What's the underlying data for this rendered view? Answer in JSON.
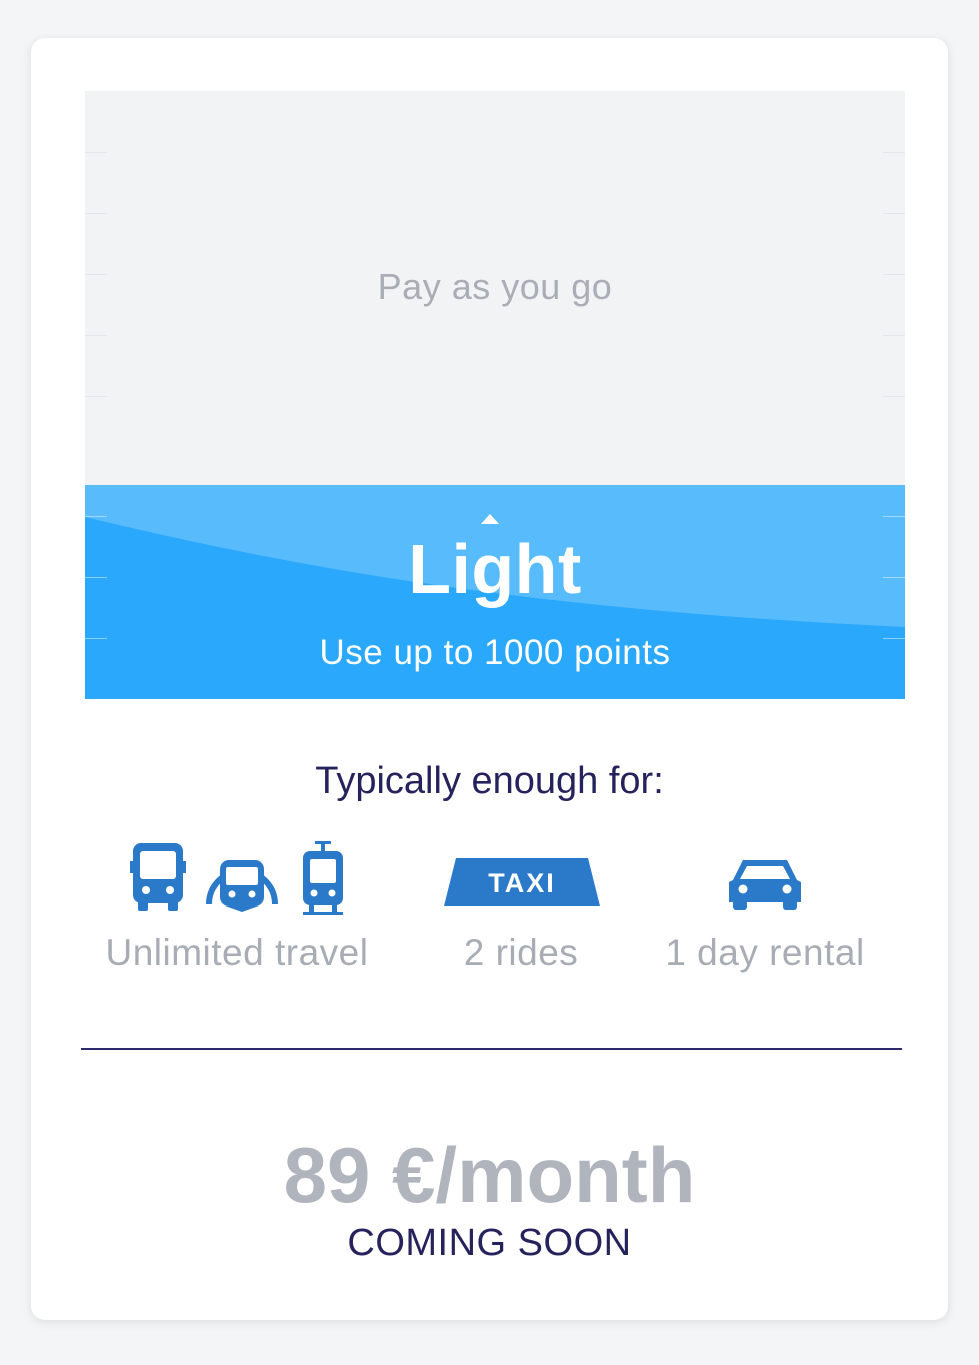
{
  "plan_card": {
    "payg_label": "Pay as you go",
    "plan_name": "Light",
    "plan_subtitle": "Use up to 1000 points",
    "features_title": "Typically enough for:",
    "features": [
      {
        "icons": [
          "bus-icon",
          "metro-icon",
          "tram-icon"
        ],
        "label": "Unlimited travel"
      },
      {
        "icons": [
          "taxi-icon"
        ],
        "label": "2 rides",
        "icon_text": "TAXI"
      },
      {
        "icons": [
          "car-icon"
        ],
        "label": "1 day rental"
      }
    ],
    "price": "89 €/month",
    "status": "COMING SOON"
  },
  "colors": {
    "accent_blue": "#2aa8fb",
    "icon_blue": "#2b7ac9",
    "navy_text": "#26235c",
    "muted_text": "#a7acb5"
  }
}
